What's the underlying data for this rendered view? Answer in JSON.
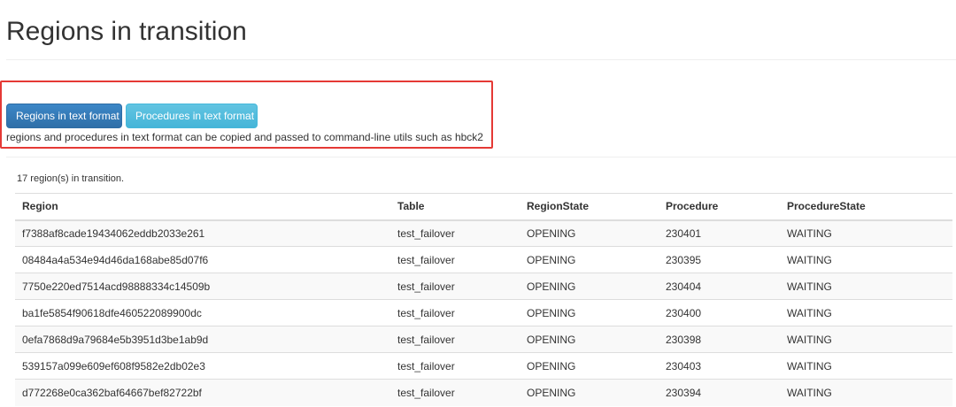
{
  "page": {
    "title": "Regions in transition"
  },
  "actions": {
    "regions_text_label": "Regions in text format",
    "procedures_text_label": "Procedures in text format",
    "note": "regions and procedures in text format can be copied and passed to command-line utils such as hbck2"
  },
  "summary": {
    "count_text": "17 region(s) in transition."
  },
  "table": {
    "headers": {
      "region": "Region",
      "table": "Table",
      "region_state": "RegionState",
      "procedure": "Procedure",
      "procedure_state": "ProcedureState"
    },
    "rows": [
      {
        "region": "f7388af8cade19434062eddb2033e261",
        "table": "test_failover",
        "region_state": "OPENING",
        "procedure": "230401",
        "procedure_state": "WAITING"
      },
      {
        "region": "08484a4a534e94d46da168abe85d07f6",
        "table": "test_failover",
        "region_state": "OPENING",
        "procedure": "230395",
        "procedure_state": "WAITING"
      },
      {
        "region": "7750e220ed7514acd98888334c14509b",
        "table": "test_failover",
        "region_state": "OPENING",
        "procedure": "230404",
        "procedure_state": "WAITING"
      },
      {
        "region": "ba1fe5854f90618dfe460522089900dc",
        "table": "test_failover",
        "region_state": "OPENING",
        "procedure": "230400",
        "procedure_state": "WAITING"
      },
      {
        "region": "0efa7868d9a79684e5b3951d3be1ab9d",
        "table": "test_failover",
        "region_state": "OPENING",
        "procedure": "230398",
        "procedure_state": "WAITING"
      },
      {
        "region": "539157a099e609ef608f9582e2db02e3",
        "table": "test_failover",
        "region_state": "OPENING",
        "procedure": "230403",
        "procedure_state": "WAITING"
      },
      {
        "region": "d772268e0ca362baf64667bef82722bf",
        "table": "test_failover",
        "region_state": "OPENING",
        "procedure": "230394",
        "procedure_state": "WAITING"
      }
    ]
  },
  "colors": {
    "primary": "#337ab7",
    "info": "#5bc0de",
    "highlight": "#e53935"
  }
}
